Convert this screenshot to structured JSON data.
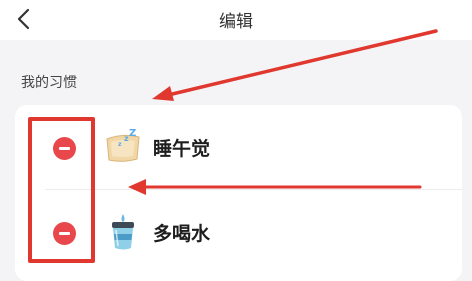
{
  "header": {
    "title": "编辑"
  },
  "section": {
    "label": "我的习惯"
  },
  "habits": [
    {
      "name": "睡午觉",
      "icon": "pillow-icon"
    },
    {
      "name": "多喝水",
      "icon": "water-cup-icon"
    }
  ],
  "colors": {
    "remove_button": "#e8484b",
    "annotation": "#e0372f"
  }
}
